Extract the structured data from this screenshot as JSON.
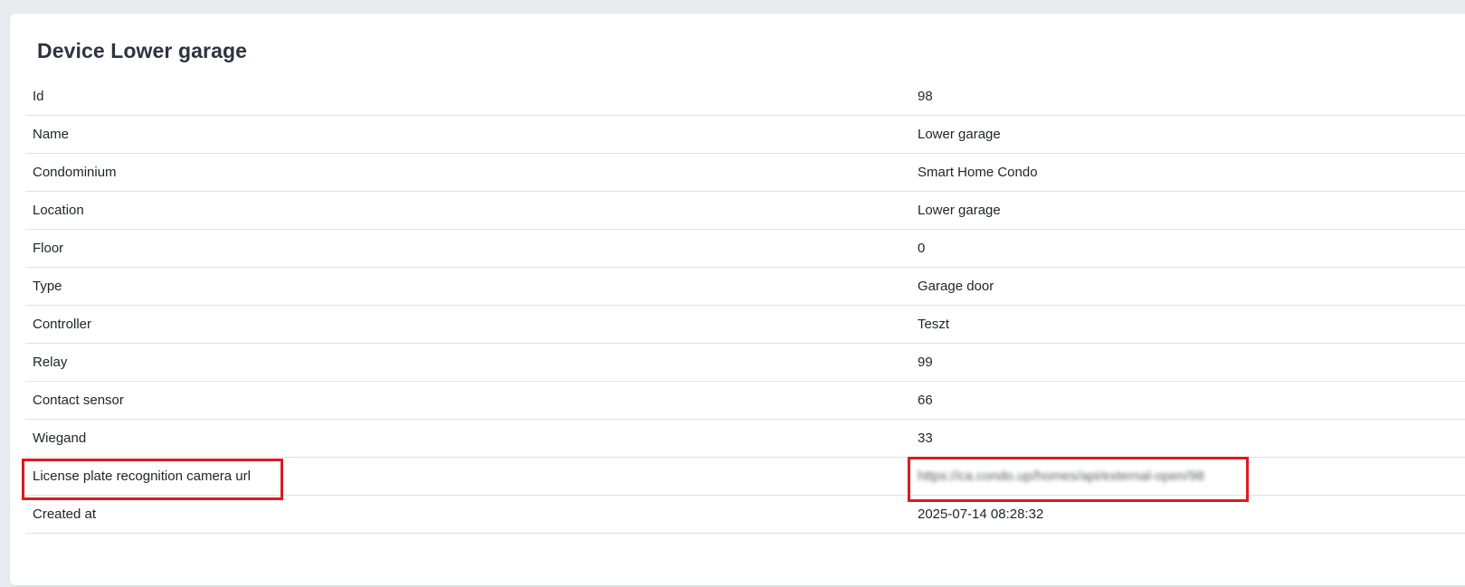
{
  "page": {
    "title": "Device Lower garage"
  },
  "details": [
    {
      "label": "Id",
      "value": "98"
    },
    {
      "label": "Name",
      "value": "Lower garage"
    },
    {
      "label": "Condominium",
      "value": "Smart Home Condo"
    },
    {
      "label": "Location",
      "value": "Lower garage"
    },
    {
      "label": "Floor",
      "value": "0"
    },
    {
      "label": "Type",
      "value": "Garage door"
    },
    {
      "label": "Controller",
      "value": "Teszt"
    },
    {
      "label": "Relay",
      "value": "99"
    },
    {
      "label": "Contact sensor",
      "value": "66"
    },
    {
      "label": "Wiegand",
      "value": "33"
    },
    {
      "label": "License plate recognition camera url",
      "value": "https://ca.condo.up/homes/api/external-open/98"
    },
    {
      "label": "Created at",
      "value": "2025-07-14 08:28:32"
    }
  ],
  "colors": {
    "highlight": "#e0191f",
    "background": "#e9ebee",
    "card": "#ffffff",
    "divider": "#dee2e6"
  }
}
